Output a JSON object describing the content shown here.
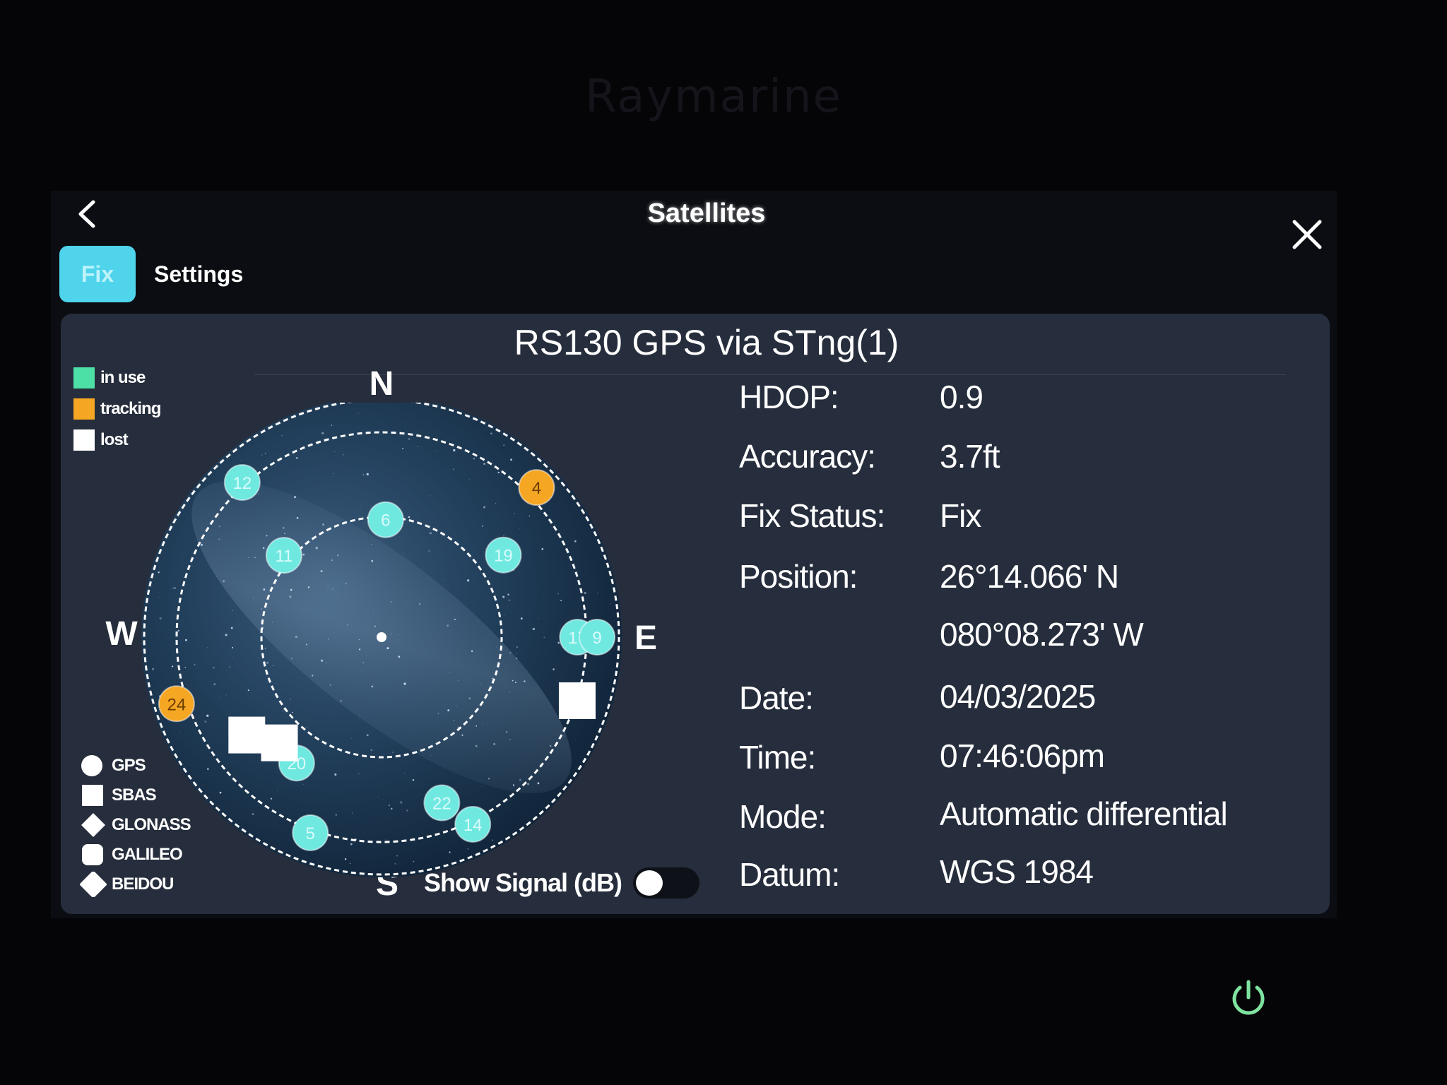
{
  "bezel": {
    "brand": "Raymarine"
  },
  "header": {
    "title": "Satellites"
  },
  "tabs": [
    {
      "label": "Fix",
      "active": true
    },
    {
      "label": "Settings",
      "active": false
    }
  ],
  "panel": {
    "title": "RS130 GPS via STng(1)"
  },
  "legend": {
    "status": [
      {
        "label": "in use",
        "color": "#4de0a6"
      },
      {
        "label": "tracking",
        "color": "#f5a623"
      },
      {
        "label": "lost",
        "color": "#ffffff"
      }
    ],
    "types": [
      {
        "label": "GPS",
        "shape": "circle"
      },
      {
        "label": "SBAS",
        "shape": "square"
      },
      {
        "label": "GLONASS",
        "shape": "diamond"
      },
      {
        "label": "GALILEO",
        "shape": "rounded-square"
      },
      {
        "label": "BEIDOU",
        "shape": "rounded-diamond"
      }
    ]
  },
  "compass": {
    "north": "N",
    "south": "S",
    "east": "E",
    "west": "W"
  },
  "sky_plot": {
    "satellites": [
      {
        "id": "12",
        "status": "in-use",
        "type": "GPS",
        "azimuth": 318,
        "elevation": 5
      },
      {
        "id": "6",
        "status": "in-use",
        "type": "GPS",
        "azimuth": 2,
        "elevation": 42
      },
      {
        "id": "4",
        "status": "tracking",
        "type": "GPS",
        "azimuth": 46,
        "elevation": 2
      },
      {
        "id": "11",
        "status": "in-use",
        "type": "GPS",
        "azimuth": 310,
        "elevation": 38
      },
      {
        "id": "19",
        "status": "in-use",
        "type": "GPS",
        "azimuth": 56,
        "elevation": 30
      },
      {
        "id": "17",
        "status": "in-use",
        "type": "GPS",
        "azimuth": 90,
        "elevation": 10
      },
      {
        "id": "9",
        "status": "in-use",
        "type": "GPS",
        "azimuth": 90,
        "elevation": 2
      },
      {
        "id": "24",
        "status": "tracking",
        "type": "GPS",
        "azimuth": 252,
        "elevation": 2
      },
      {
        "id": "20",
        "status": "in-use",
        "type": "GPS",
        "azimuth": 214,
        "elevation": 28
      },
      {
        "id": "22",
        "status": "in-use",
        "type": "GPS",
        "azimuth": 160,
        "elevation": 18
      },
      {
        "id": "14",
        "status": "in-use",
        "type": "GPS",
        "azimuth": 154,
        "elevation": 5
      },
      {
        "id": "5",
        "status": "in-use",
        "type": "GPS",
        "azimuth": 200,
        "elevation": 5
      },
      {
        "id": "",
        "status": "lost",
        "type": "SBAS",
        "azimuth": 108,
        "elevation": 6
      },
      {
        "id": "",
        "status": "lost",
        "type": "SBAS",
        "azimuth": 234,
        "elevation": 22
      },
      {
        "id": "",
        "status": "lost",
        "type": "SBAS",
        "azimuth": 224,
        "elevation": 30
      }
    ]
  },
  "info": [
    {
      "label": "HDOP:",
      "value": "0.9"
    },
    {
      "label": "Accuracy:",
      "value": "3.7ft"
    },
    {
      "label": "Fix Status:",
      "value": "Fix"
    },
    {
      "label": "Position:",
      "value": "26°14.066' N"
    },
    {
      "label": "",
      "value": "080°08.273' W"
    },
    {
      "label": "Date:",
      "value": "04/03/2025"
    },
    {
      "label": "Time:",
      "value": "07:46:06pm"
    },
    {
      "label": "Mode:",
      "value": "Automatic differential"
    },
    {
      "label": "Datum:",
      "value": "WGS 1984"
    }
  ],
  "signal": {
    "label": "Show Signal (dB)",
    "enabled": false
  }
}
